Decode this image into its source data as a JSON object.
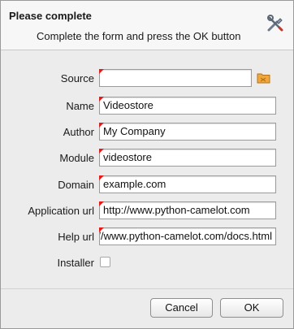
{
  "header": {
    "title": "Please complete",
    "subtitle": "Complete the form and press the OK button",
    "icon": "tools-icon"
  },
  "form": {
    "source": {
      "label": "Source",
      "value": "",
      "icon": "folder-icon"
    },
    "name": {
      "label": "Name",
      "value": "Videostore"
    },
    "author": {
      "label": "Author",
      "value": "My Company"
    },
    "module": {
      "label": "Module",
      "value": "videostore"
    },
    "domain": {
      "label": "Domain",
      "value": "example.com"
    },
    "application_url": {
      "label": "Application url",
      "value": "http://www.python-camelot.com"
    },
    "help_url": {
      "label": "Help url",
      "value": "http://www.python-camelot.com/docs.html"
    },
    "installer": {
      "label": "Installer",
      "checked": false
    }
  },
  "buttons": {
    "cancel": "Cancel",
    "ok": "OK"
  },
  "colors": {
    "required_marker": "#e21b1b",
    "folder_icon": "#e89a2c"
  }
}
